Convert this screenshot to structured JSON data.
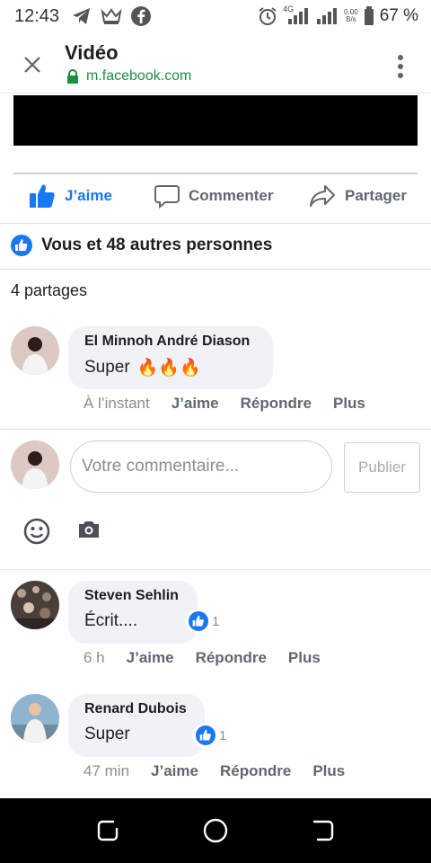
{
  "status_bar": {
    "time": "12:43",
    "net_type": "4G",
    "speed_top": "0.00",
    "speed_bottom": "B/s",
    "battery": "67 %"
  },
  "header": {
    "title": "Vidéo",
    "url": "m.facebook.com"
  },
  "actions": {
    "like_label": "J’aime",
    "comment_label": "Commenter",
    "share_label": "Partager"
  },
  "reactions_text": "Vous et 48 autres personnes",
  "shares_text": "4 partages",
  "comments": [
    {
      "author": "El Minnoh André Diason",
      "text": "Super",
      "emoji": "🔥🔥🔥",
      "time": "À l’instant",
      "like": "J’aime",
      "reply": "Répondre",
      "more": "Plus"
    },
    {
      "author": "Steven Sehlin",
      "text": "Écrit....",
      "reaction_count": "1",
      "time": "6 h",
      "like": "J’aime",
      "reply": "Répondre",
      "more": "Plus"
    },
    {
      "author": "Renard Dubois",
      "text": "Super",
      "reaction_count": "1",
      "time": "47 min",
      "like": "J’aime",
      "reply": "Répondre",
      "more": "Plus"
    }
  ],
  "composer": {
    "placeholder": "Votre commentaire...",
    "publish_label": "Publier"
  },
  "colors": {
    "facebook_blue": "#1877f2",
    "secure_green": "#1e8e3e",
    "bubble_gray": "#f0f2f5"
  }
}
